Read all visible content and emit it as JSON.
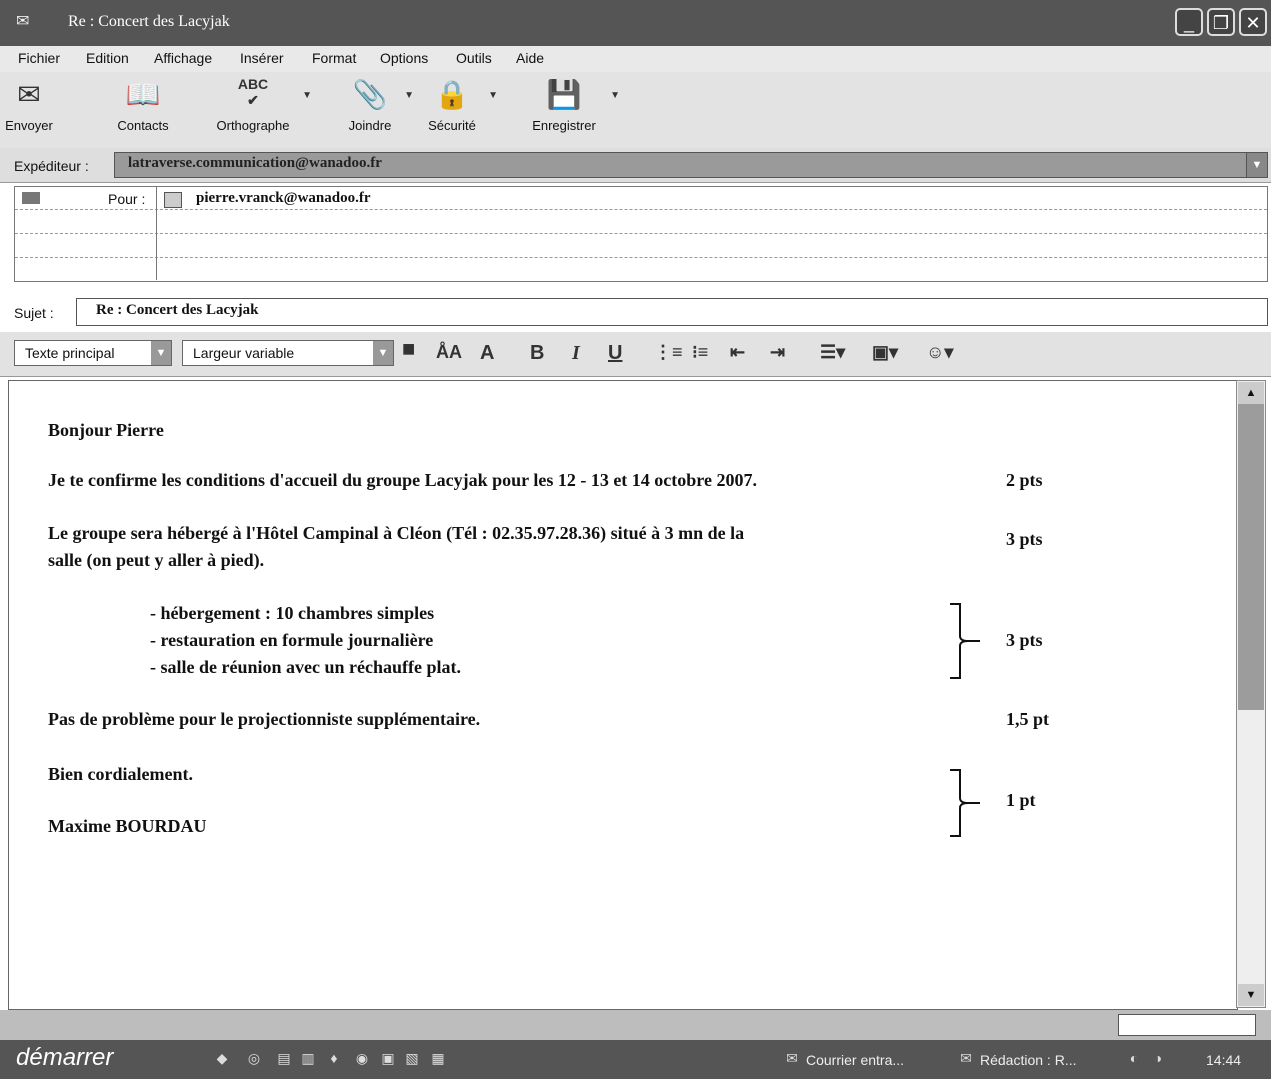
{
  "window": {
    "title": "Re : Concert des Lacyjak",
    "controls": [
      "_",
      "❐",
      "✕"
    ]
  },
  "menu": [
    "Fichier",
    "Edition",
    "Affichage",
    "Insérer",
    "Format",
    "Options",
    "Outils",
    "Aide"
  ],
  "toolbar": {
    "buttons": [
      {
        "label": "Envoyer",
        "icon": "send-icon"
      },
      {
        "label": "Contacts",
        "icon": "contacts-icon"
      },
      {
        "label": "Orthographe",
        "icon": "spellcheck-icon",
        "abc": "ABC"
      },
      {
        "label": "Joindre",
        "icon": "paperclip-icon"
      },
      {
        "label": "Sécurité",
        "icon": "lock-icon"
      },
      {
        "label": "Enregistrer",
        "icon": "save-icon"
      }
    ]
  },
  "header": {
    "sender_label": "Expéditeur :",
    "sender_value": "latraverse.communication@wanadoo.fr",
    "to_label": "Pour :",
    "to_value": "pierre.vranck@wanadoo.fr",
    "subject_label": "Sujet :",
    "subject_value": "Re : Concert des Lacyjak"
  },
  "format_bar": {
    "style": "Texte principal",
    "font": "Largeur variable",
    "buttons": [
      "B",
      "I",
      "U"
    ]
  },
  "body": {
    "greeting": "Bonjour Pierre",
    "line1": "Je te confirme les conditions d'accueil du groupe Lacyjak pour les 12 - 13 et 14 octobre 2007.",
    "line2a": "Le groupe sera hébergé à l'Hôtel Campinal à Cléon (Tél : 02.35.97.28.36) situé à 3 mn de la",
    "line2b": "salle (on peut y aller à pied).",
    "bullet1": "- hébergement : 10  chambres simples",
    "bullet2": "- restauration en formule journalière",
    "bullet3": "- salle de réunion avec un  réchauffe plat.",
    "line3": "Pas de problème pour le projectionniste supplémentaire.",
    "closing": "Bien cordialement.",
    "signature": "Maxime BOURDAU"
  },
  "grading": {
    "p1": "2 pts",
    "p2": "3 pts",
    "p3": "3 pts",
    "p4": "1,5 pt",
    "p5": "1 pt"
  },
  "taskbar": {
    "start": "démarrer",
    "tasks": [
      "Courrier entra...",
      "Rédaction : R..."
    ],
    "clock": "14:44"
  }
}
